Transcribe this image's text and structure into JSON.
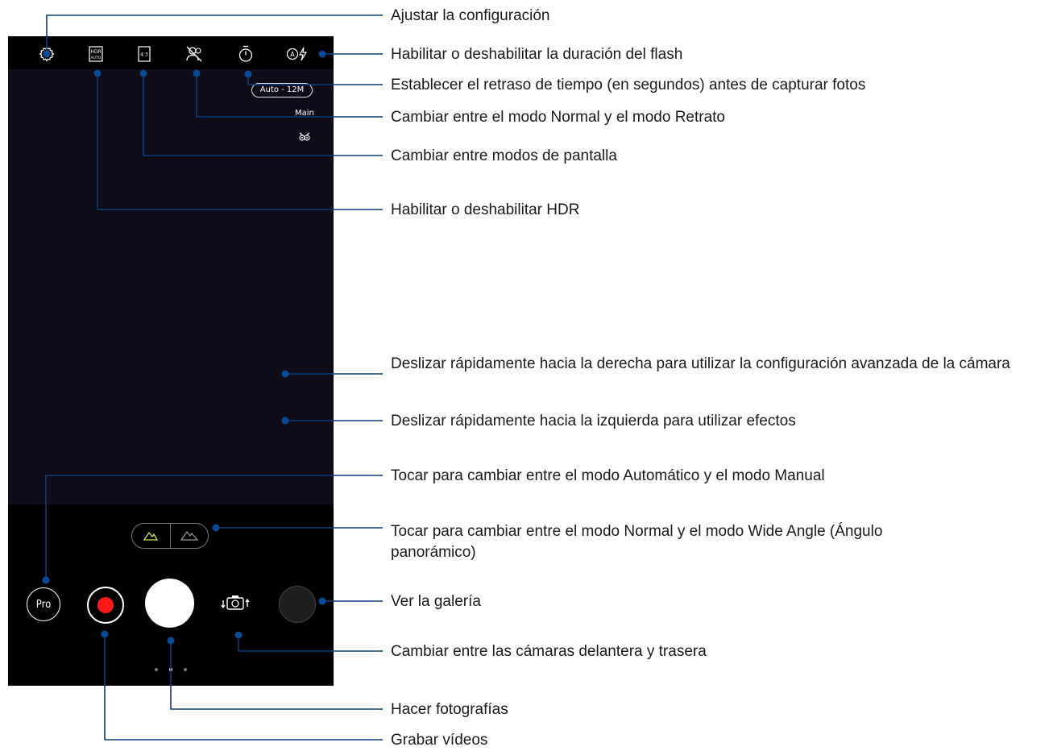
{
  "camera": {
    "resolution_chip": "Auto - 12M",
    "lens_label": "Main",
    "pro_label": "Pro",
    "page_dots": 3,
    "active_page_dot": 1,
    "top_icons": [
      "settings-gear-icon",
      "hdr-auto-icon",
      "aspect-ratio-4-3-icon",
      "portrait-off-icon",
      "timer-icon",
      "auto-flash-icon"
    ],
    "hdr_text_top": "HDR",
    "hdr_text_bottom": "AUTO",
    "aspect_text": "4:3",
    "flash_mode_letter": "A"
  },
  "annotations": [
    "Ajustar la configuración",
    "Habilitar o deshabilitar la duración del flash",
    "Establecer el retraso de tiempo (en segundos) antes de capturar fotos",
    "Cambiar entre el modo Normal y el modo Retrato",
    "Cambiar entre modos de pantalla",
    "Habilitar o deshabilitar HDR",
    "Deslizar rápidamente hacia la derecha para utilizar la configuración avanzada de la cámara",
    "Deslizar rápidamente hacia la izquierda para utilizar efectos",
    "Tocar para cambiar entre el modo Automático y el modo Manual",
    "Tocar para cambiar entre el modo Normal y el modo Wide Angle (Ángulo panorámico)",
    "Ver la galería",
    "Cambiar entre las cámaras delantera y trasera",
    "Hacer fotografías",
    "Grabar vídeos"
  ],
  "colors": {
    "callout_line": "#0a3d7a",
    "callout_dot": "#0a4a94",
    "record_red": "#ff1a1a",
    "wide_mode_green": "#c8e64a"
  }
}
